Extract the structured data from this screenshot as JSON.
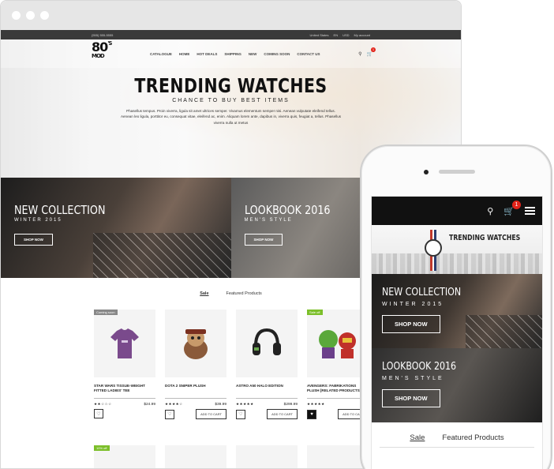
{
  "browser": {
    "topbar": {
      "phone": "(555) 555-5555",
      "region": "United States",
      "lang": "EN",
      "currency": "USD",
      "account": "My account"
    },
    "nav": {
      "logo_main": "80",
      "logo_sup": "'S",
      "logo_sub": "MOD",
      "menu": [
        "CATALOGUE",
        "HOME",
        "HOT DEALS",
        "SHIPPING",
        "NEW",
        "COMING SOON",
        "CONTACT US"
      ],
      "cart_count": "1"
    },
    "hero": {
      "title": "TRENDING WATCHES",
      "subtitle": "CHANCE TO BUY BEST ITEMS",
      "body": "Phasellus tempus. Proin viverra, ligula sit amet ultrices semper. Vivamus elementum semper nisi. Aenean vulputate eleifend tellus. Aenean leo ligula, porttitor eu, consequat vitae, eleifend ac, enim. Aliquam lorem ante, dapibus in, viverra quis, feugiat a, tellus. Phasellus viverra nulla ut metus"
    },
    "banners": [
      {
        "title": "NEW COLLECTION",
        "subtitle": "WINTER 2015",
        "button": "SHOP NOW"
      },
      {
        "title": "LOOKBOOK 2016",
        "subtitle": "MEN'S STYLE",
        "button": "SHOP NOW"
      }
    ],
    "tabs": [
      "Sale",
      "Featured Products"
    ],
    "products": [
      {
        "tag": "Coming soon",
        "name": "STAR WARS TISSUE-WEIGHT FITTED LADIES' TEE",
        "price": "$24.99",
        "stars": "★★☆☆☆",
        "cart": ""
      },
      {
        "tag": "",
        "name": "DOTA 2 SNIPER PLUSH",
        "price": "$39.99",
        "stars": "★★★★☆",
        "cart": "ADD TO CART"
      },
      {
        "tag": "",
        "name": "ASTRO A50 HALO EDITION",
        "price": "$299.99",
        "stars": "★★★★★",
        "cart": "ADD TO CART"
      },
      {
        "tag": "Sale off",
        "name": "AVENGERS: FABRIKATIONS PLUSH [RELATED PRODUCTS]",
        "price": "$14",
        "stars": "★★★★★",
        "cart": "ADD TO CART"
      }
    ],
    "products_second_row_tag": "10% off"
  },
  "phone": {
    "cart_count": "1",
    "hero_title": "TRENDING WATCHES",
    "banners": [
      {
        "title": "NEW COLLECTION",
        "subtitle": "WINTER 2015",
        "button": "SHOP NOW"
      },
      {
        "title": "LOOKBOOK 2016",
        "subtitle": "MEN'S STYLE",
        "button": "SHOP NOW"
      }
    ],
    "tabs": [
      "Sale",
      "Featured Products"
    ]
  },
  "icons": [
    "search-icon",
    "cart-icon",
    "menu-icon",
    "heart-icon"
  ],
  "colors": {
    "badge": "#e2231a",
    "dark": "#111111",
    "sale_tag": "#7cbf2a"
  }
}
